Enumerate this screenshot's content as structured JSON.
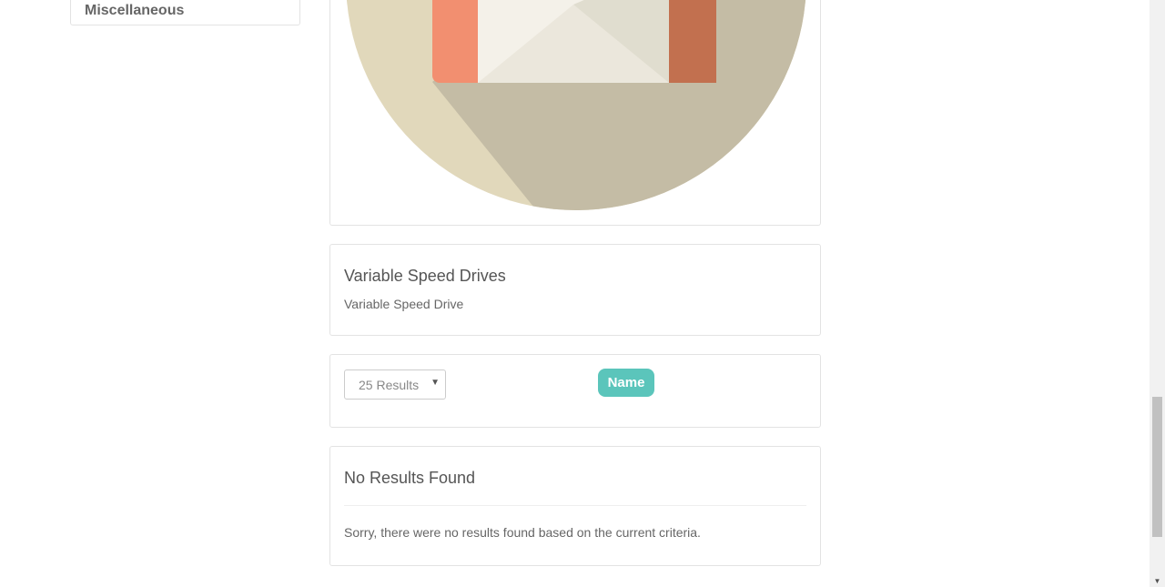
{
  "sidebar": {
    "items": [
      {
        "label": "Miscellaneous"
      }
    ]
  },
  "category": {
    "image_icon": "envelope-icon",
    "title": "Variable Speed Drives",
    "description": "Variable Speed Drive"
  },
  "filters": {
    "results_per_page": "25 Results",
    "sort_button": "Name"
  },
  "results": {
    "title": "No Results Found",
    "message": "Sorry, there were no results found based on the current criteria."
  },
  "colors": {
    "accent": "#5bc5bb",
    "circle_light": "#e1d8bb",
    "circle_shadow": "#c4bca5",
    "envelope_left": "#f28f70",
    "envelope_right": "#c2704f"
  }
}
